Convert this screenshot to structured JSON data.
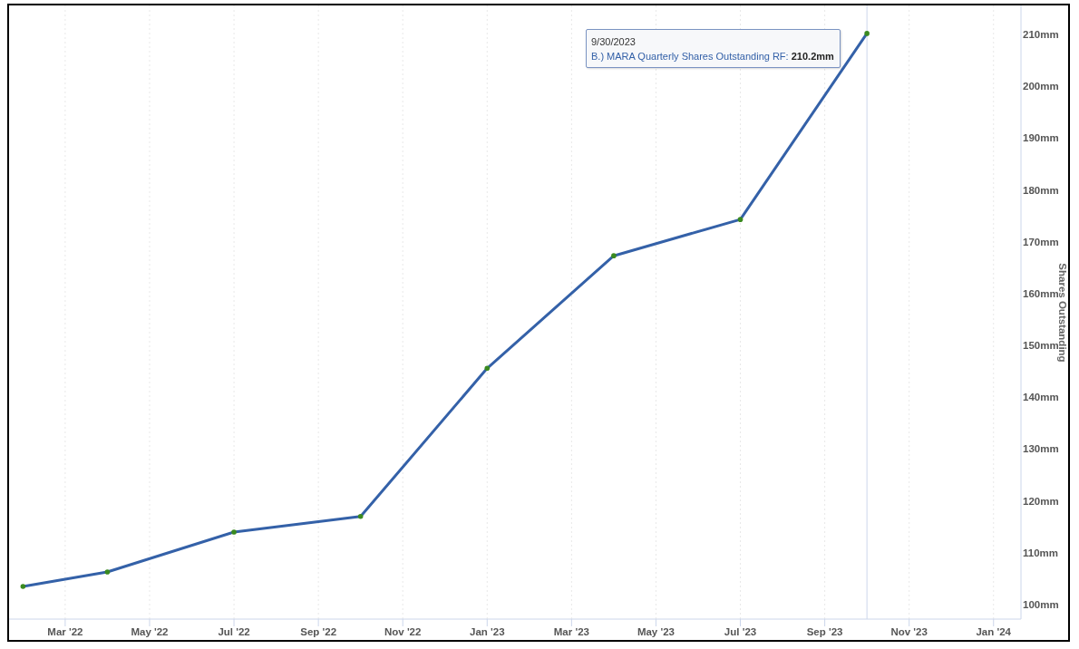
{
  "chart": {
    "chart_data": {
      "type": "line",
      "ylabel": "Shares Outstanding",
      "categories": [
        null,
        "Mar '22",
        null,
        "May '22",
        null,
        "Jul '22",
        null,
        "Sep '22",
        null,
        "Nov '22",
        null,
        "Jan '23",
        null,
        "Mar '23",
        null,
        "May '23",
        null,
        "Jul '23",
        null,
        "Sep '23",
        null,
        "Nov '23",
        null,
        "Jan '24"
      ],
      "series": [
        {
          "name": "B.) MARA Quarterly Shares Outstanding RF",
          "color": "#3461a8",
          "values": [
            103.5,
            null,
            106.3,
            null,
            null,
            114.0,
            null,
            null,
            117.0,
            null,
            null,
            145.6,
            null,
            null,
            167.3,
            null,
            null,
            174.3,
            null,
            null,
            210.2,
            null,
            null,
            null
          ]
        }
      ],
      "grid": true,
      "ylim": [
        97.2,
        215.6
      ],
      "yticks": [
        {
          "value": 100,
          "label": "100mm"
        },
        {
          "value": 110,
          "label": "110mm"
        },
        {
          "value": 120,
          "label": "120mm"
        },
        {
          "value": 130,
          "label": "130mm"
        },
        {
          "value": 140,
          "label": "140mm"
        },
        {
          "value": 150,
          "label": "150mm"
        },
        {
          "value": 160,
          "label": "160mm"
        },
        {
          "value": 170,
          "label": "170mm"
        },
        {
          "value": 180,
          "label": "180mm"
        },
        {
          "value": 190,
          "label": "190mm"
        },
        {
          "value": 200,
          "label": "200mm"
        },
        {
          "value": 210,
          "label": "210mm"
        }
      ]
    },
    "tooltip": {
      "date": "9/30/2023",
      "separator": ":",
      "value": "210.2mm"
    }
  }
}
